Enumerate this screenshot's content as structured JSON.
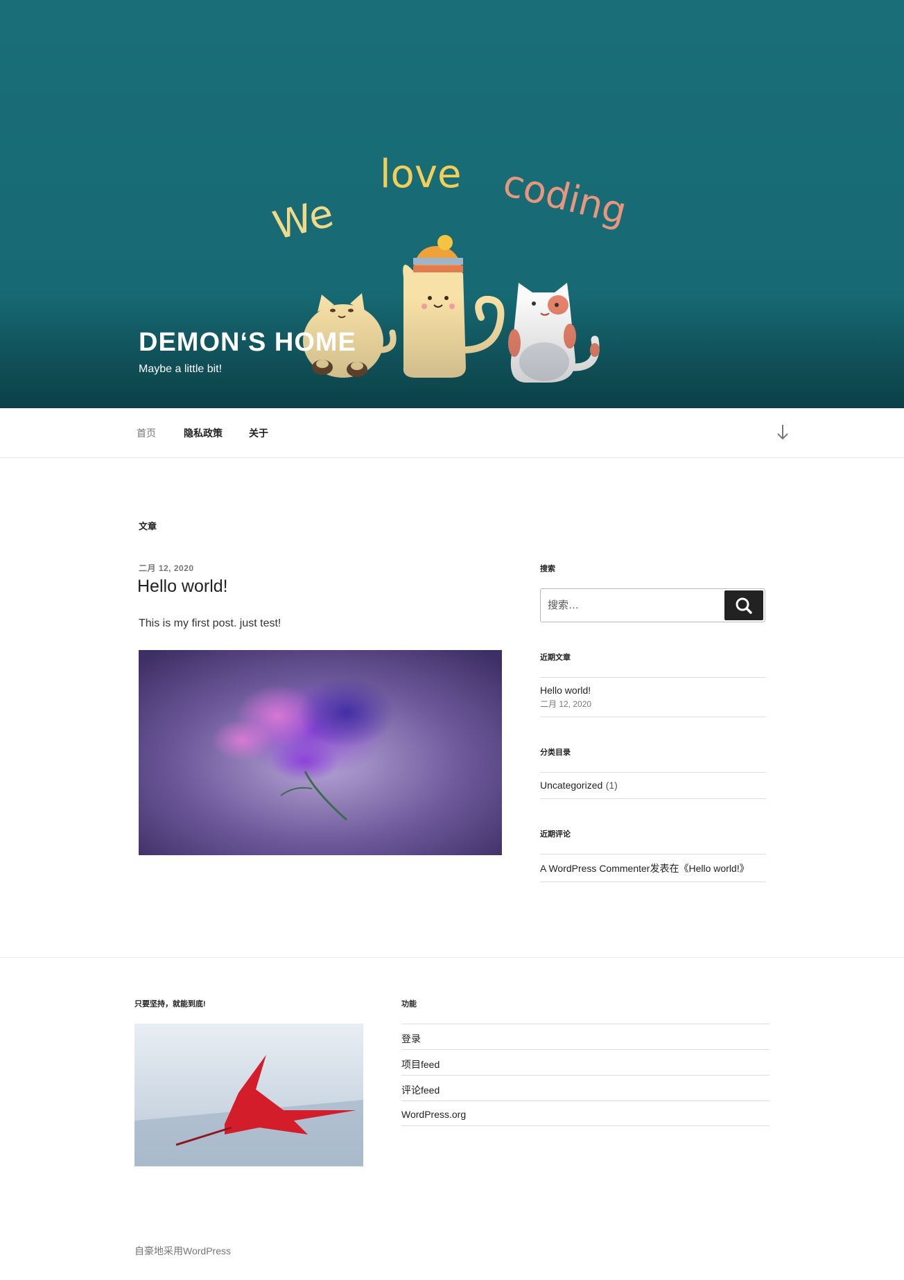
{
  "header": {
    "site_title": "DEMON‘S HOME",
    "site_description": "Maybe a little bit!",
    "art_words": [
      "We",
      "love",
      "coding"
    ]
  },
  "nav": {
    "items": [
      {
        "label": "首页"
      },
      {
        "label": "隐私政策"
      },
      {
        "label": "关于"
      }
    ],
    "scroll_icon": "arrow-down-icon"
  },
  "main": {
    "archive_title": "文章",
    "post": {
      "date": "二月 12, 2020",
      "title": "Hello world!",
      "excerpt": "This is my first post. just test!"
    }
  },
  "sidebar": {
    "search": {
      "title": "搜索",
      "placeholder": "搜索…",
      "button_icon": "search-icon"
    },
    "recent_posts": {
      "title": "近期文章",
      "items": [
        {
          "label": "Hello world!",
          "date": "二月 12, 2020"
        }
      ]
    },
    "categories": {
      "title": "分类目录",
      "items": [
        {
          "label": "Uncategorized",
          "count": "(1)"
        }
      ]
    },
    "recent_comments": {
      "title": "近期评论",
      "items": [
        {
          "author": "A WordPress Commenter",
          "text": "发表在《Hello world!》"
        }
      ]
    }
  },
  "footer": {
    "widget1_title": "只要坚持，就能到底!",
    "widget2_title": "功能",
    "meta_links": [
      {
        "label": "登录"
      },
      {
        "label": "项目feed"
      },
      {
        "label": "评论feed"
      },
      {
        "label": "WordPress.org"
      }
    ],
    "credit": "自豪地采用WordPress"
  },
  "colors": {
    "header_bg": "#1a6e78",
    "accent_dark": "#222222",
    "muted": "#767676"
  }
}
